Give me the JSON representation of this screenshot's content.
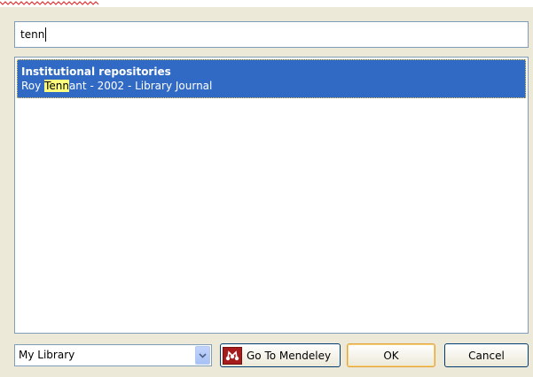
{
  "search": {
    "value": "tenn"
  },
  "results": [
    {
      "title": "Institutional repositories",
      "author_pre": "Roy ",
      "author_match": "Tenn",
      "author_post": "ant",
      "meta_rest": " - 2002 - Library Journal"
    }
  ],
  "library_select": {
    "value": "My Library"
  },
  "buttons": {
    "go_to_mendeley": "Go To Mendeley",
    "ok": "OK",
    "cancel": "Cancel"
  },
  "icons": {
    "dropdown": "chevron-down-icon",
    "mendeley": "mendeley-logo-icon"
  },
  "colors": {
    "selection": "#316ac5",
    "highlight": "#fefe7e",
    "logo": "#a61c1c"
  }
}
